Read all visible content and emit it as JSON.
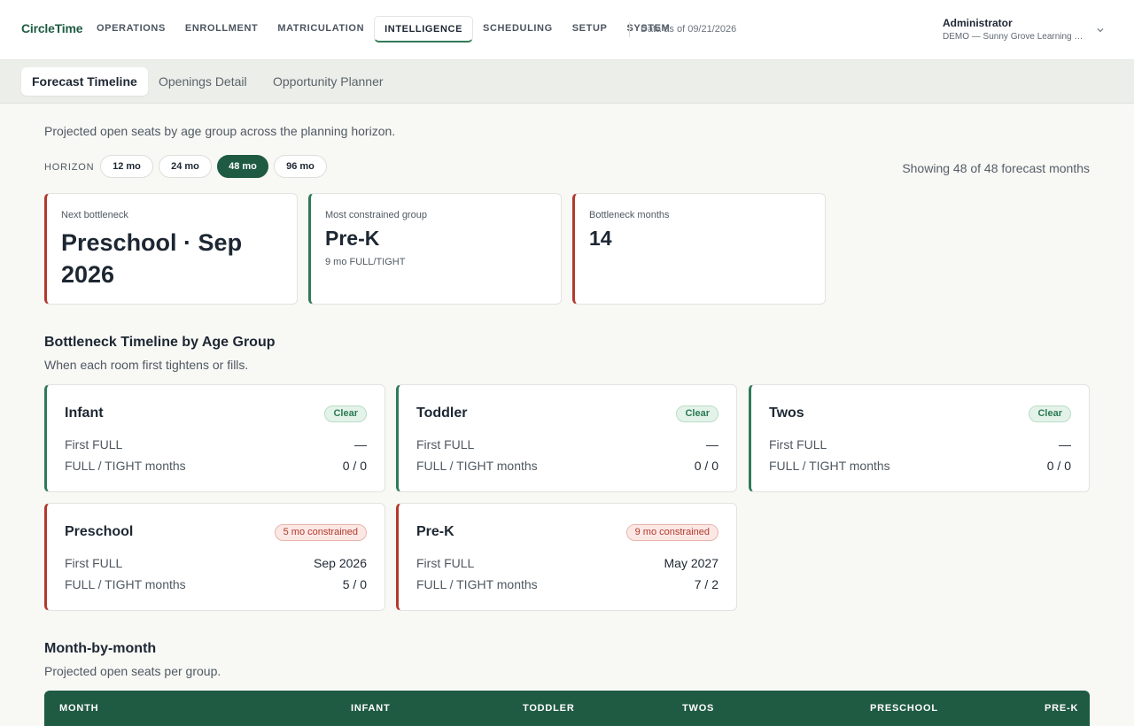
{
  "app": {
    "brand": "CircleTime",
    "nav": [
      "OPERATIONS",
      "ENROLLMENT",
      "MATRICULATION",
      "INTELLIGENCE",
      "SCHEDULING",
      "SETUP",
      "SYSTEM"
    ],
    "active_nav": "INTELLIGENCE",
    "as_of": "Data as of 09/21/2026",
    "user_role": "Administrator",
    "user_org": "DEMO — Sunny Grove Learning Center"
  },
  "subtabs": [
    "Forecast Timeline",
    "Openings Detail",
    "Opportunity Planner"
  ],
  "active_subtab": "Forecast Timeline",
  "intro": "Projected open seats by age group across the planning horizon.",
  "horizon": {
    "label": "HORIZON",
    "options": [
      "12 mo",
      "24 mo",
      "48 mo",
      "96 mo"
    ],
    "selected": "48 mo",
    "showing": "Showing 48 of 48 forecast months"
  },
  "kpis": {
    "next_bottleneck": {
      "label": "Next bottleneck",
      "value": "Preschool · Sep 2026"
    },
    "most_constrained": {
      "label": "Most constrained group",
      "value": "Pre-K",
      "sub": "9 mo FULL/TIGHT"
    },
    "bottleneck_months": {
      "label": "Bottleneck months",
      "value": "14"
    }
  },
  "timeline": {
    "title": "Bottleneck Timeline by Age Group",
    "subtitle": "When each room first tightens or fills.",
    "first_full_label": "First FULL",
    "months_label": "FULL / TIGHT months",
    "groups": [
      {
        "name": "Infant",
        "status": "Clear",
        "first_full": "—",
        "months": "0 / 0"
      },
      {
        "name": "Toddler",
        "status": "Clear",
        "first_full": "—",
        "months": "0 / 0"
      },
      {
        "name": "Twos",
        "status": "Clear",
        "first_full": "—",
        "months": "0 / 0"
      },
      {
        "name": "Preschool",
        "status": "5 mo constrained",
        "first_full": "Sep 2026",
        "months": "5 / 0"
      },
      {
        "name": "Pre-K",
        "status": "9 mo constrained",
        "first_full": "May 2027",
        "months": "7 / 2"
      }
    ]
  },
  "monthly": {
    "title": "Month-by-month",
    "subtitle": "Projected open seats per group.",
    "columns": [
      "MONTH",
      "INFANT",
      "TODDLER",
      "TWOS",
      "PRESCHOOL",
      "PRE-K"
    ]
  },
  "colors": {
    "brand_green": "#1f5a43",
    "accent_green": "#2f7a58",
    "alert_red": "#b3392c"
  }
}
